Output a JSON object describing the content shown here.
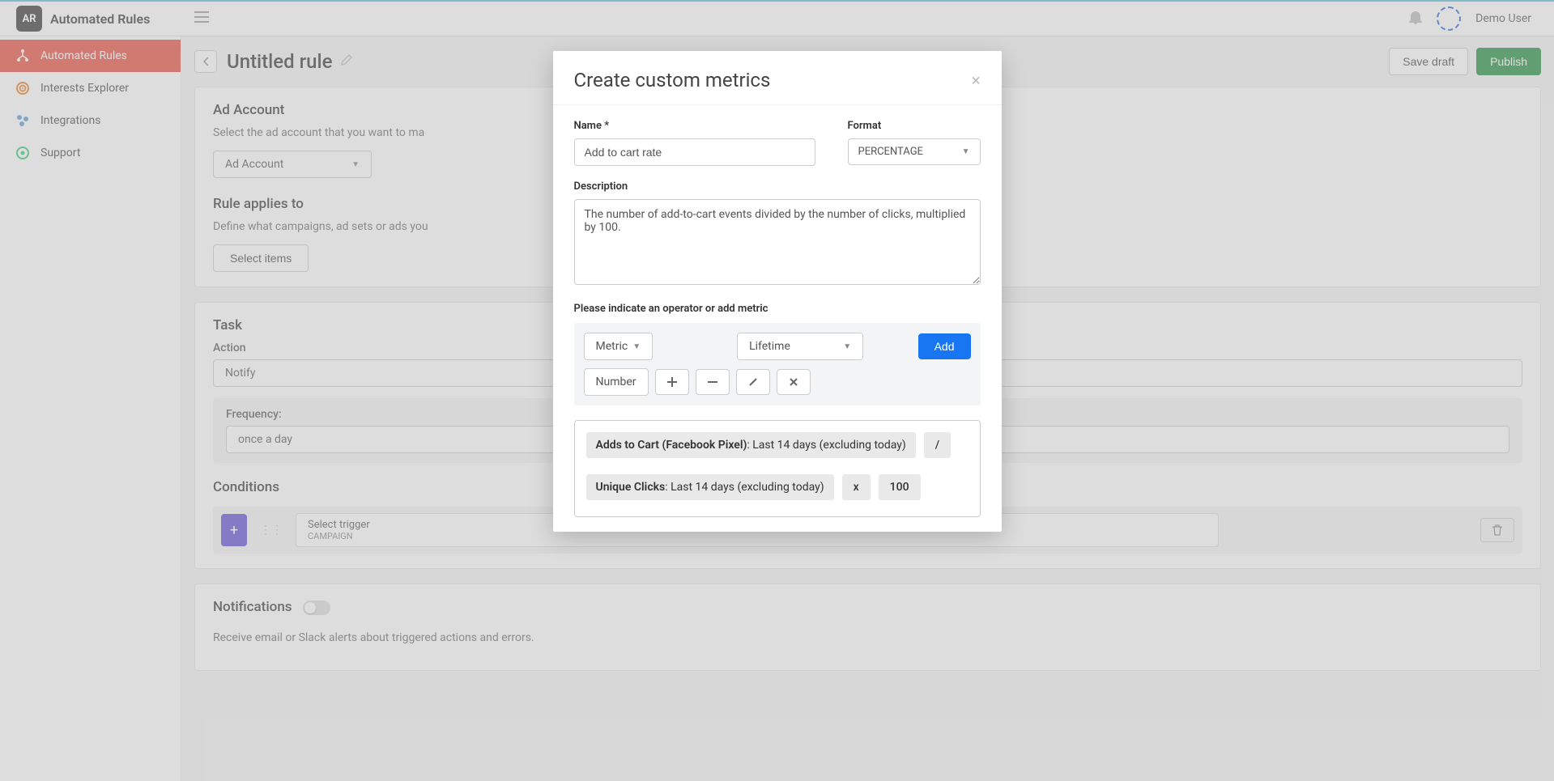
{
  "brand": {
    "logo_text": "AR",
    "title": "Automated Rules"
  },
  "topbar": {
    "user_name": "Demo User"
  },
  "sidebar": {
    "items": [
      {
        "label": "Automated Rules",
        "active": true
      },
      {
        "label": "Interests Explorer",
        "active": false
      },
      {
        "label": "Integrations",
        "active": false
      },
      {
        "label": "Support",
        "active": false
      }
    ]
  },
  "page": {
    "title": "Untitled rule",
    "save_draft_label": "Save draft",
    "publish_label": "Publish"
  },
  "ad_account_card": {
    "title": "Ad Account",
    "subtitle": "Select the ad account that you want to ma",
    "select_value": "Ad Account",
    "applies_title": "Rule applies to",
    "applies_subtitle": "Define what campaigns, ad sets or ads you",
    "select_items_label": "Select items"
  },
  "task_card": {
    "title": "Task",
    "action_label": "Action",
    "action_value": "Notify",
    "frequency_label": "Frequency:",
    "frequency_value": "once a day"
  },
  "conditions_card": {
    "title": "Conditions",
    "trigger_title": "Select trigger",
    "trigger_sub": "CAMPAIGN"
  },
  "notifications_card": {
    "title": "Notifications",
    "subtitle": "Receive email or Slack alerts about triggered actions and errors."
  },
  "modal": {
    "title": "Create custom metrics",
    "name_label": "Name *",
    "name_value": "Add to cart rate",
    "format_label": "Format",
    "format_value": "PERCENTAGE",
    "description_label": "Description",
    "description_value": "The number of add-to-cart events divided by the number of clicks, multiplied by 100.",
    "operator_hint": "Please indicate an operator or add metric",
    "metric_btn": "Metric",
    "timeframe_value": "Lifetime",
    "add_label": "Add",
    "number_btn": "Number",
    "operators": {
      "plus": "+",
      "minus": "−",
      "divide": "/",
      "multiply": "x"
    },
    "formula": {
      "chip1_name": "Adds to Cart (Facebook Pixel)",
      "chip1_range": ": Last 14 days (excluding today)",
      "op1": "/",
      "chip2_name": "Unique Clicks",
      "chip2_range": ": Last 14 days (excluding today)",
      "op2": "x",
      "chip3": "100"
    }
  }
}
